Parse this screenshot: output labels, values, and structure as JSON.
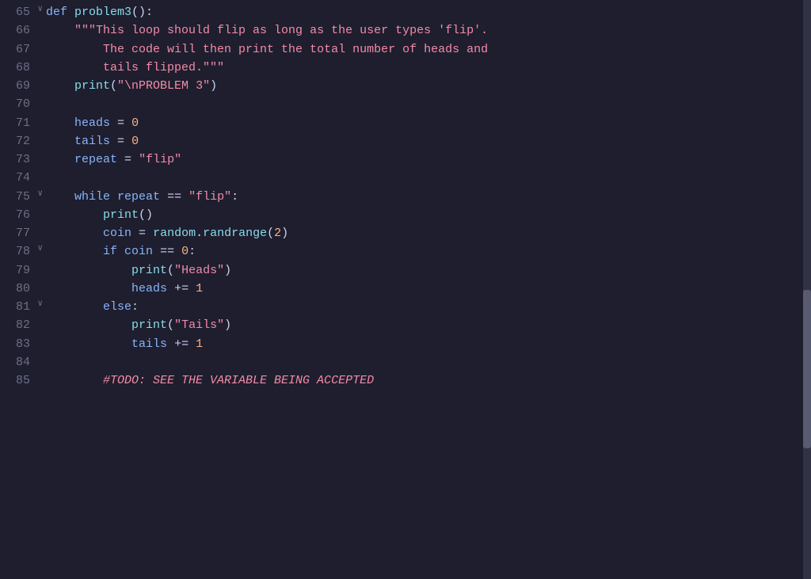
{
  "colors": {
    "background": "#1e1e2e",
    "lineNum": "#6c7086",
    "default": "#cdd6f4",
    "keyword": "#89b4fa",
    "function": "#89dceb",
    "string": "#f38ba8",
    "number": "#fab387",
    "comment": "#f38ba8"
  },
  "lines": [
    {
      "num": 65,
      "fold": true,
      "content": "def_problem3_open"
    },
    {
      "num": 66,
      "content": "docstring_1"
    },
    {
      "num": 67,
      "content": "docstring_2"
    },
    {
      "num": 68,
      "content": "docstring_3"
    },
    {
      "num": 69,
      "content": "print_problem3"
    },
    {
      "num": 70,
      "content": "empty"
    },
    {
      "num": 71,
      "content": "heads_assign"
    },
    {
      "num": 72,
      "content": "tails_assign"
    },
    {
      "num": 73,
      "content": "repeat_assign"
    },
    {
      "num": 74,
      "content": "empty"
    },
    {
      "num": 75,
      "fold": true,
      "content": "while_repeat"
    },
    {
      "num": 76,
      "content": "print_empty"
    },
    {
      "num": 77,
      "content": "coin_assign"
    },
    {
      "num": 78,
      "fold": true,
      "content": "if_coin"
    },
    {
      "num": 79,
      "content": "print_heads"
    },
    {
      "num": 80,
      "content": "heads_increment"
    },
    {
      "num": 81,
      "fold": true,
      "content": "else_block"
    },
    {
      "num": 82,
      "content": "print_tails"
    },
    {
      "num": 83,
      "content": "tails_increment"
    },
    {
      "num": 84,
      "content": "empty"
    },
    {
      "num": 85,
      "content": "comment_todo"
    }
  ]
}
